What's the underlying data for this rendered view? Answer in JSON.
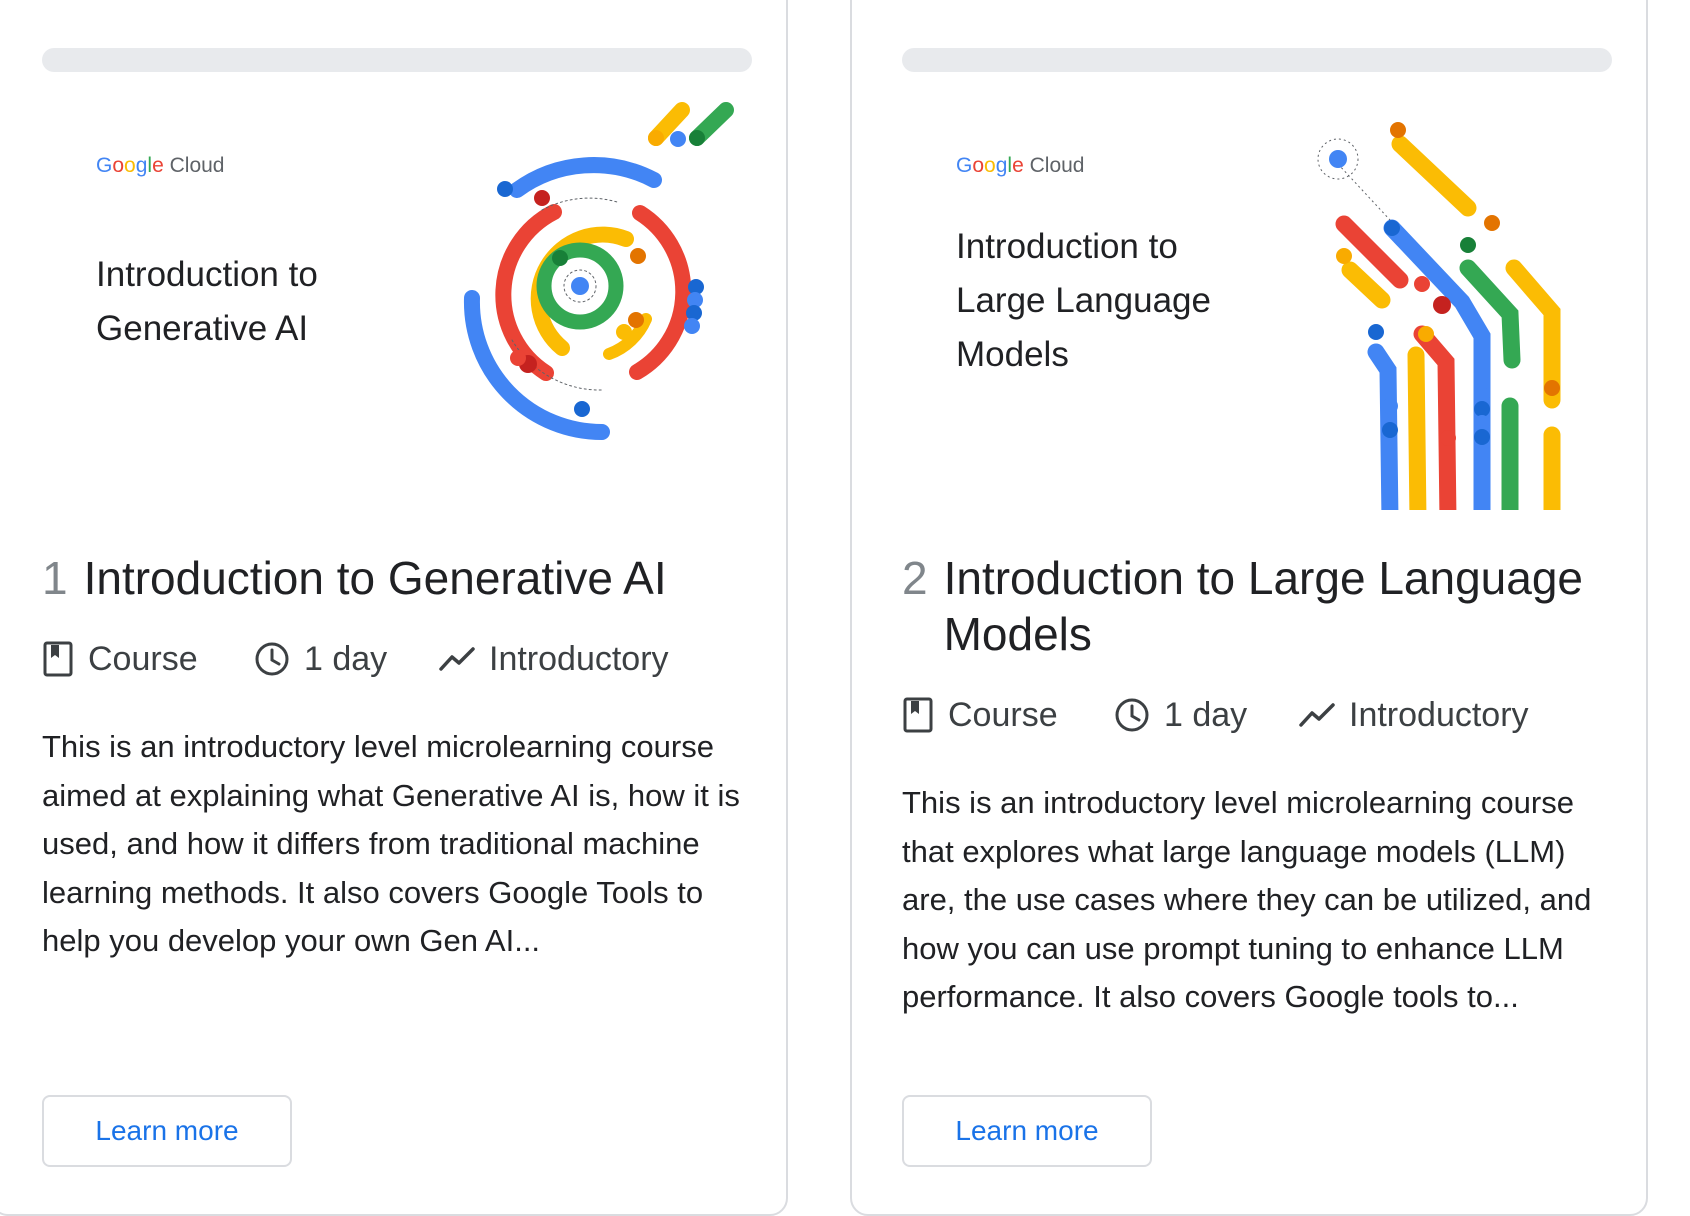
{
  "logo": {
    "brand_letters": [
      "G",
      "o",
      "o",
      "g",
      "l",
      "e"
    ],
    "product": "Cloud"
  },
  "colors": {
    "blue": "#4285f4",
    "red": "#ea4335",
    "yellow": "#fbbc04",
    "green": "#34a853",
    "link": "#1a73e8"
  },
  "cards": [
    {
      "number": "1",
      "banner_title_lines": [
        "Introduction to",
        "Generative AI"
      ],
      "title": "Introduction to Generative AI",
      "meta": {
        "type": "Course",
        "duration": "1 day",
        "level": "Introductory"
      },
      "description": "This is an introductory level microlearning course aimed at explaining what Generative AI is, how it is used, and how it differs from traditional machine learning methods. It also covers Google Tools to help you develop your own Gen AI...",
      "button_label": "Learn more"
    },
    {
      "number": "2",
      "banner_title_lines": [
        "Introduction to",
        "Large Language",
        "Models"
      ],
      "title": "Introduction to Large Language Models",
      "meta": {
        "type": "Course",
        "duration": "1 day",
        "level": "Introductory"
      },
      "description": "This is an introductory level microlearning course that explores what large language models (LLM) are, the use cases where they can be utilized, and how you can use prompt tuning to enhance LLM performance. It also covers Google tools to...",
      "button_label": "Learn more"
    }
  ]
}
